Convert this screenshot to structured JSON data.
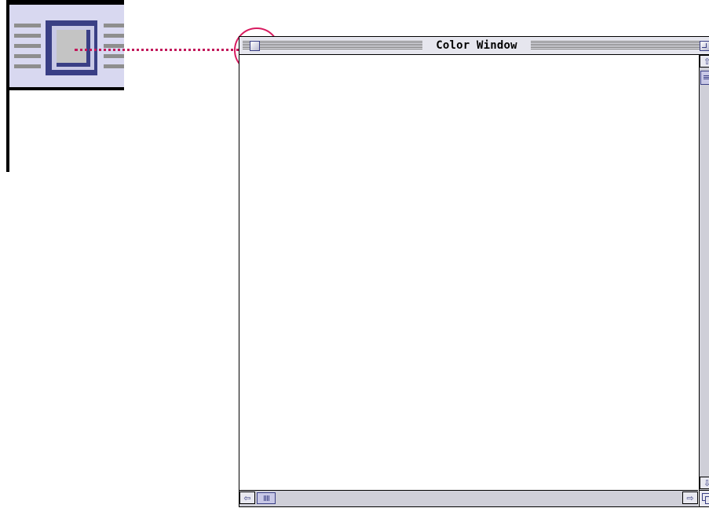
{
  "window": {
    "title": "Color Window",
    "close_box": "close-box-icon",
    "zoom_box": "zoom-box-icon"
  },
  "scrollbars": {
    "vertical": {
      "up_arrow": "⇧",
      "down_arrow": "⇩"
    },
    "horizontal": {
      "left_arrow": "⇦",
      "right_arrow": "⇨"
    },
    "grow_box": "size-box-icon"
  },
  "colors": {
    "accent": "#3a3f85",
    "chrome": "#e6e6ee",
    "highlight": "#d81b60"
  }
}
